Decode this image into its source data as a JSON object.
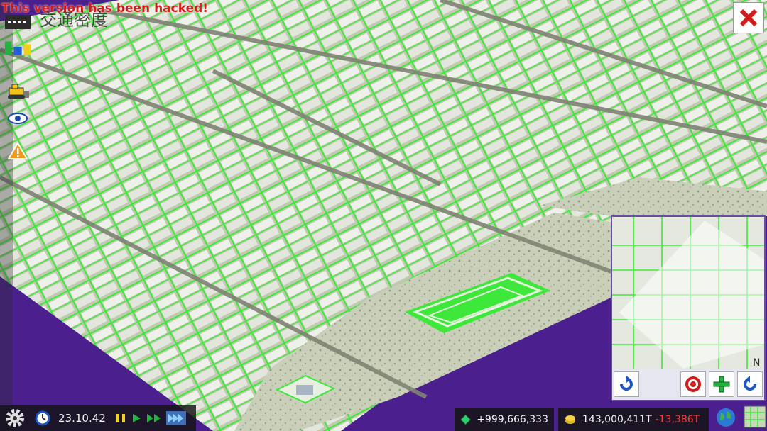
{
  "overlay": {
    "hack_message": "This version has been hacked!",
    "layer_title": "交通密度"
  },
  "left_tools": [
    {
      "icon": "road-layer-icon"
    },
    {
      "icon": "bar-chart-icon"
    },
    {
      "icon": "bulldozer-icon"
    },
    {
      "icon": "eye-icon"
    },
    {
      "icon": "warning-icon"
    }
  ],
  "colors": {
    "road_green": "#3ee83a",
    "ground": "#c7cdb6",
    "building": "#e9ece4",
    "background_purple": "#4b1f8e",
    "negative_red": "#ff3b3b"
  },
  "bottom_bar": {
    "date": "23.10.42",
    "speed_controls": [
      "pause",
      "play",
      "fast",
      "fastest"
    ],
    "active_speed": "fastest"
  },
  "stats": {
    "diamonds": "+999,666,333",
    "money": "143,000,411T",
    "money_change": "-13,386T"
  },
  "minimap": {
    "compass": "N"
  }
}
